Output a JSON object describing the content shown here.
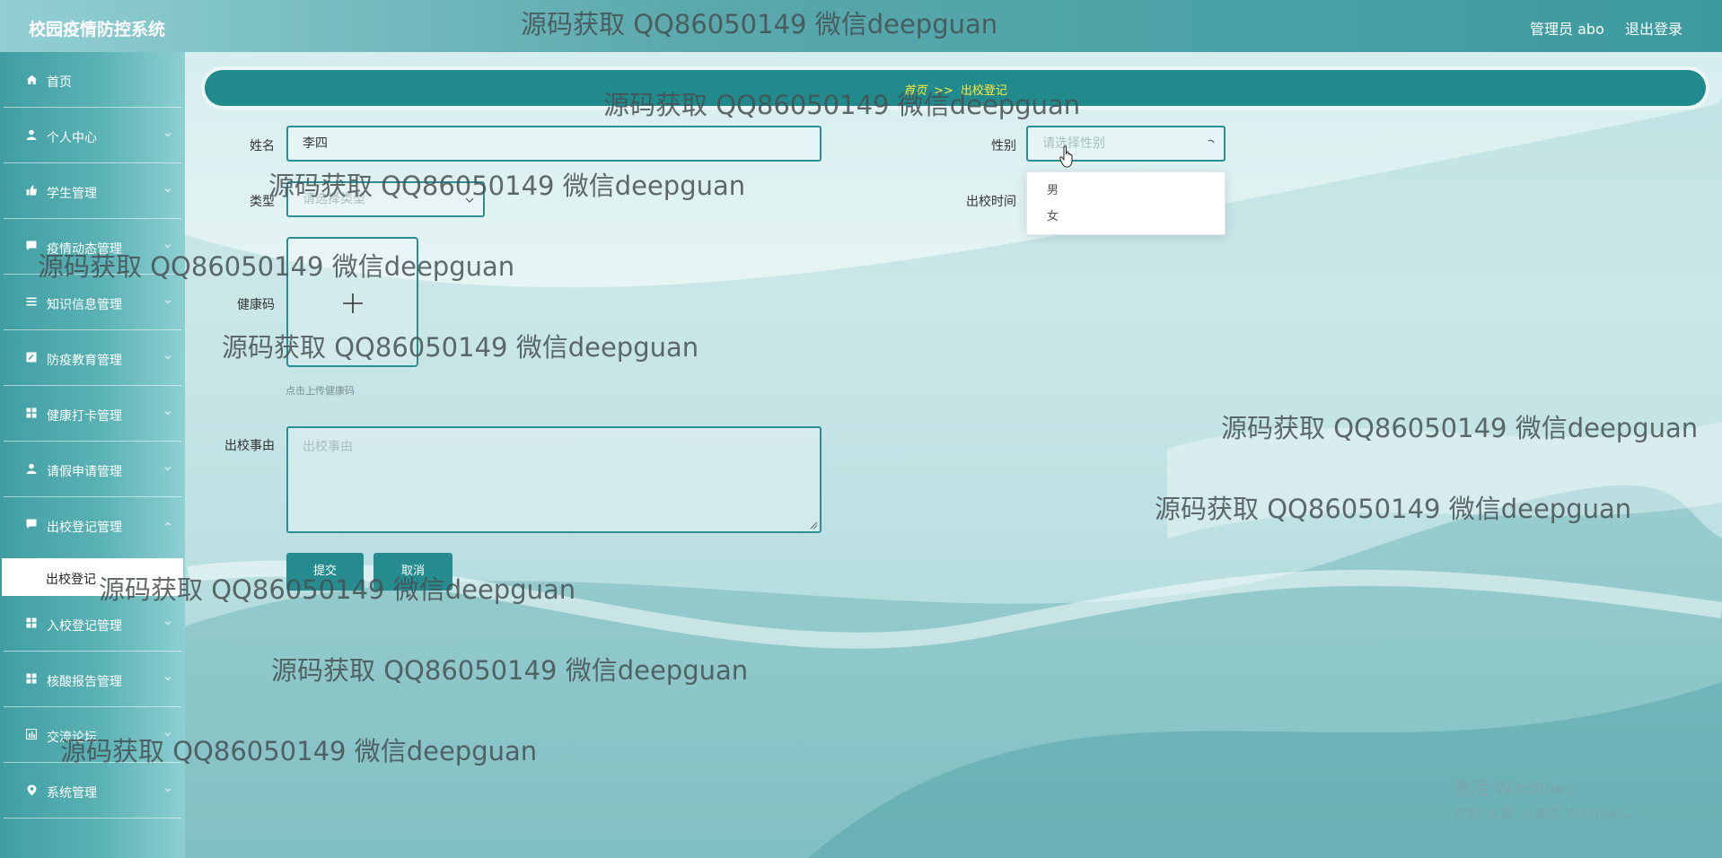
{
  "header": {
    "app_title": "校园疫情防控系统",
    "user_label": "管理员 abo",
    "logout_label": "退出登录"
  },
  "sidebar": {
    "items": [
      {
        "label": "首页",
        "icon": "home-icon"
      },
      {
        "label": "个人中心",
        "icon": "user-icon"
      },
      {
        "label": "学生管理",
        "icon": "thumb-icon"
      },
      {
        "label": "疫情动态管理",
        "icon": "message-icon"
      },
      {
        "label": "知识信息管理",
        "icon": "list-icon"
      },
      {
        "label": "防疫教育管理",
        "icon": "edit-icon"
      },
      {
        "label": "健康打卡管理",
        "icon": "grid-icon"
      },
      {
        "label": "请假申请管理",
        "icon": "user-icon"
      },
      {
        "label": "出校登记管理",
        "icon": "message-icon"
      },
      {
        "label": "入校登记管理",
        "icon": "grid-icon"
      },
      {
        "label": "核酸报告管理",
        "icon": "grid-icon"
      },
      {
        "label": "交流论坛",
        "icon": "chart-icon"
      },
      {
        "label": "系统管理",
        "icon": "location-icon"
      }
    ],
    "active_sub_item": "出校登记"
  },
  "breadcrumb": {
    "home": "首页",
    "separator": ">>",
    "current": "出校登记"
  },
  "form": {
    "name_label": "姓名",
    "name_value": "李四",
    "gender_label": "性别",
    "gender_placeholder": "请选择性别",
    "type_label": "类型",
    "type_placeholder": "请选择类型",
    "time_label": "出校时间",
    "health_code_label": "健康码",
    "upload_tip": "点击上传健康码",
    "reason_label": "出校事由",
    "reason_placeholder": "出校事由",
    "submit_label": "提交",
    "cancel_label": "取消"
  },
  "gender_dropdown": {
    "options": [
      "男",
      "女"
    ]
  },
  "watermarks": [
    "源码获取 QQ86050149 微信deepguan",
    "源码获取 QQ86050149 微信deepguan",
    "源码获取 QQ86050149 微信deepguan",
    "源码获取 QQ86050149 微信deepguan",
    "源码获取 QQ86050149 微信deepguan",
    "源码获取 QQ86050149 微信deepguan",
    "源码获取 QQ86050149 微信deepguan",
    "源码获取 QQ86050149 微信deepguan",
    "源码获取 QQ86050149 微信deepguan",
    "源码获取 QQ86050149 微信deepguan"
  ],
  "os_notice": {
    "line1": "激活 Windows",
    "line2": "转到“设置”以激活 Windows。"
  },
  "colors": {
    "accent": "#268c8f",
    "breadcrumb_text": "#ffea3a"
  }
}
